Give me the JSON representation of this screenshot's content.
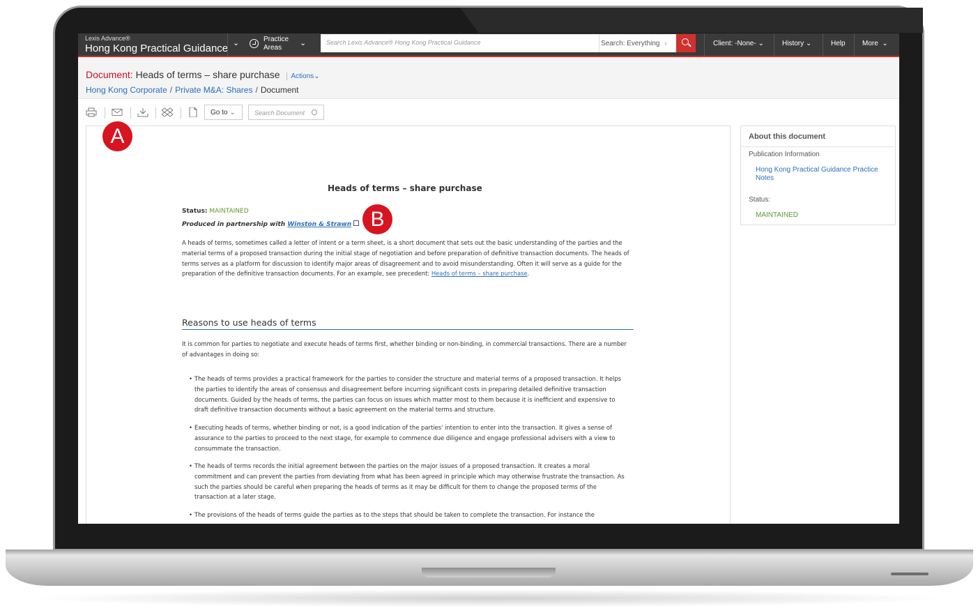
{
  "topnav": {
    "brand_small": "Lexis Advance®",
    "brand_name": "Hong Kong Practical Guidance",
    "practice_areas_line1": "Practice",
    "practice_areas_line2": "Areas",
    "search_placeholder": "Search Lexis Advance® Hong Kong Practical Guidance",
    "search_scope": "Search: Everything",
    "client": "Client: -None-",
    "history": "History",
    "help": "Help",
    "more": "More"
  },
  "header": {
    "title_label": "Document:",
    "title": "Heads of terms – share purchase",
    "actions": "Actions"
  },
  "breadcrumb": {
    "items": [
      "Hong Kong Corporate",
      "Private M&A: Shares",
      "Document"
    ]
  },
  "toolbar": {
    "goto": "Go to",
    "search_placeholder": "Search Document"
  },
  "markers": {
    "a": "A",
    "b": "B"
  },
  "document": {
    "title": "Heads of terms – share purchase",
    "status_label": "Status:",
    "status_value": "MAINTAINED",
    "produced_prefix": "Produced in partnership with",
    "partner": "Winston & Strawn",
    "intro_text": "A heads of terms, sometimes called a letter of intent or a term sheet, is a short document that sets out the basic understanding of the parties and the material terms of a proposed transaction during the initial stage of negotiation and before preparation of definitive transaction documents. The heads of terms serves as a platform for discussion to identify major areas of disagreement and to avoid misunderstanding. Often it will serve as a guide for the preparation of the definitive transaction documents. For an example, see precedent: ",
    "intro_link": "Heads of terms – share purchase",
    "intro_end": ".",
    "section_heading": "Reasons to use heads of terms",
    "section_intro": "It is common for parties to negotiate and execute heads of terms first, whether binding or non-binding, in commercial transactions. There are a number of advantages in doing so:",
    "bullets": [
      "The heads of terms provides a practical framework for the parties to consider the structure and material terms of a proposed transaction. It helps the parties to identify the areas of consensus and disagreement before incurring significant costs in preparing detailed definitive transaction documents. Guided by the heads of terms, the parties can focus on issues which matter most to them because it is inefficient and expensive to draft definitive transaction documents without a basic agreement on the material terms and structure.",
      "Executing heads of terms, whether binding or not, is a good indication of the parties' intention to enter into the transaction. It gives a sense of assurance to the parties to proceed to the next stage, for example to commence due diligence and engage professional advisers with a view to consummate the transaction.",
      "The heads of terms records the initial agreement between the parties on the major issues of a proposed transaction. It creates a moral commitment and can prevent the parties from deviating from what has been agreed in principle which may otherwise frustrate the transaction. As such the parties should be careful when preparing the heads of terms as it may be difficult for them to change the proposed terms of the transaction at a later stage.",
      "The provisions of the heads of terms guide the parties as to the steps that should be taken to complete the transaction. For instance the"
    ]
  },
  "sidebar": {
    "heading": "About this document",
    "pub_info_label": "Publication Information",
    "pub_link": "Hong Kong Practical Guidance Practice Notes",
    "status_label": "Status:",
    "status_value": "MAINTAINED"
  },
  "colors": {
    "accent_red": "#d0312d",
    "link_blue": "#2a6ebb",
    "status_green": "#5e9732",
    "marker_red": "#d7141f"
  }
}
